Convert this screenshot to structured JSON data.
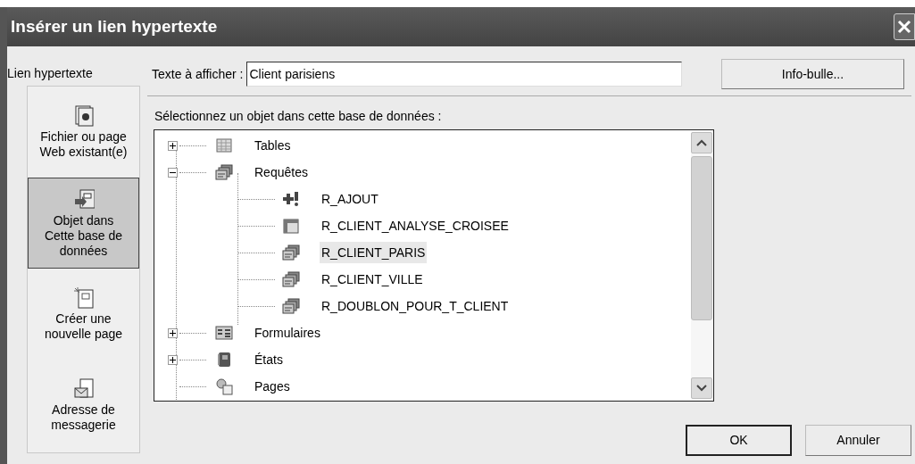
{
  "window": {
    "title": "Insérer un lien hypertexte"
  },
  "sidebar": {
    "title": "Lien hypertexte",
    "items": [
      {
        "kind": "file",
        "label": "Fichier ou page Web existant(e)",
        "selected": false
      },
      {
        "kind": "database",
        "label": "Objet dans Cette base de données",
        "selected": true
      },
      {
        "kind": "newpage",
        "label": "Créer une nouvelle page",
        "selected": false
      },
      {
        "kind": "mail",
        "label": "Adresse de messagerie",
        "selected": false
      }
    ]
  },
  "text_field": {
    "label": "Texte à afficher :",
    "value": "Client parisiens"
  },
  "tooltip_button": "Info-bulle...",
  "tree": {
    "label": "Sélectionnez un objet dans cette base de données :",
    "items": [
      {
        "kind": "table",
        "label": "Tables",
        "expanded": false,
        "selected": false
      },
      {
        "kind": "query",
        "label": "Requêtes",
        "expanded": true,
        "selected": false,
        "children": [
          {
            "kind": "append",
            "label": "R_AJOUT",
            "selected": false
          },
          {
            "kind": "crosstab",
            "label": "R_CLIENT_ANALYSE_CROISEE",
            "selected": false
          },
          {
            "kind": "query",
            "label": "R_CLIENT_PARIS",
            "selected": true
          },
          {
            "kind": "query",
            "label": "R_CLIENT_VILLE",
            "selected": false
          },
          {
            "kind": "query",
            "label": "R_DOUBLON_POUR_T_CLIENT",
            "selected": false
          }
        ]
      },
      {
        "kind": "form",
        "label": "Formulaires",
        "expanded": false,
        "selected": false
      },
      {
        "kind": "report",
        "label": "États",
        "expanded": false,
        "selected": false
      },
      {
        "kind": "page",
        "label": "Pages",
        "selected": false
      }
    ]
  },
  "buttons": [
    "OK",
    "Annuler"
  ]
}
